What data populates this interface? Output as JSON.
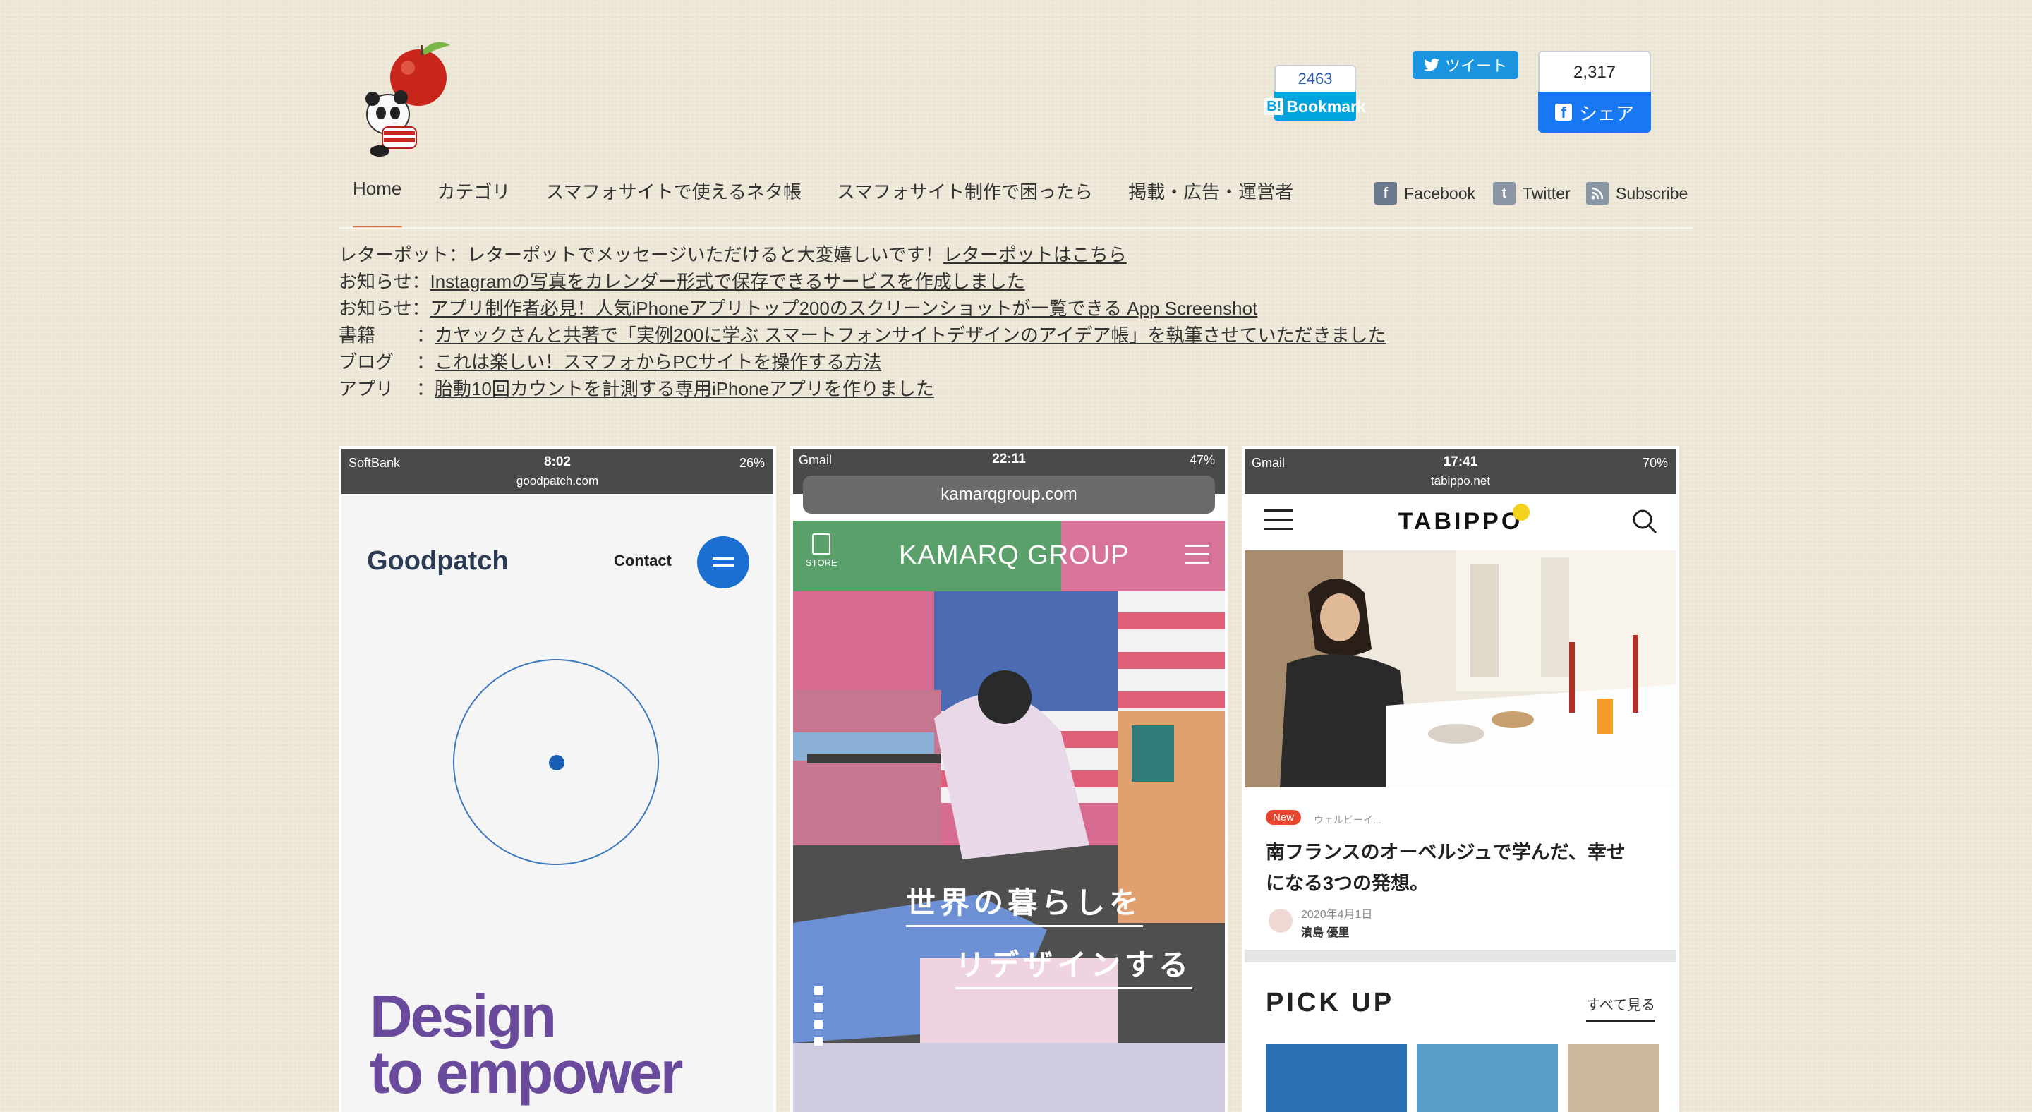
{
  "header": {
    "hatena": {
      "count": "2463",
      "label": "Bookmark",
      "b_icon": "B!"
    },
    "tweet": {
      "label": "ツイート"
    },
    "facebook_share": {
      "count": "2,317",
      "label": "シェア"
    }
  },
  "nav": {
    "items": [
      {
        "label": "Home"
      },
      {
        "label": "カテゴリ"
      },
      {
        "label": "スマフォサイトで使えるネタ帳"
      },
      {
        "label": "スマフォサイト制作で困ったら"
      },
      {
        "label": "掲載・広告・運営者"
      }
    ],
    "social": [
      {
        "label": "Facebook",
        "icon": "facebook-icon"
      },
      {
        "label": "Twitter",
        "icon": "twitter-icon"
      },
      {
        "label": "Subscribe",
        "icon": "rss-icon"
      }
    ]
  },
  "notices": [
    {
      "label": "レターポット",
      "sep": "：",
      "text": "レターポットでメッセージいただけると大変嬉しいです！",
      "link": "レターポットはこちら"
    },
    {
      "label": "お知らせ",
      "sep": "：",
      "text": "",
      "link": "Instagramの写真をカレンダー形式で保存できるサービスを作成しました"
    },
    {
      "label": "お知らせ",
      "sep": "：",
      "text": "",
      "link": "アプリ制作者必見！人気iPhoneアプリトップ200のスクリーンショットが一覧できる App Screenshot"
    },
    {
      "label": "書籍",
      "sep": "：",
      "text": "",
      "link": "カヤックさんと共著で「実例200に学ぶ スマートフォンサイトデザインのアイデア帳」を執筆させていただきました"
    },
    {
      "label": "ブログ",
      "sep": "：",
      "text": "",
      "link": "これは楽しい！スマフォからPCサイトを操作する方法"
    },
    {
      "label": "アプリ",
      "sep": "：",
      "text": "",
      "link": "胎動10回カウントを計測する専用iPhoneアプリを作りました"
    }
  ],
  "cards": {
    "goodpatch": {
      "carrier": "SoftBank",
      "time": "8:02",
      "battery": "26%",
      "url": "goodpatch.com",
      "logo": "Goodpatch",
      "contact": "Contact",
      "headline1": "Design",
      "headline2": "to empower"
    },
    "kamarq": {
      "carrier": "Gmail",
      "time": "22:11",
      "battery": "47%",
      "url": "kamarqgroup.com",
      "store": "STORE",
      "logo": "KAMARQ GROUP",
      "copy1": "世界の暮らしを",
      "copy2": "リデザインする"
    },
    "tabippo": {
      "carrier": "Gmail",
      "time": "17:41",
      "battery": "70%",
      "url": "tabippo.net",
      "logo": "TABIPPO",
      "badge": "New",
      "category": "ウェルビーイ...",
      "title1": "南フランスのオーベルジュで学んだ、幸せ",
      "title2": "になる3つの発想。",
      "date": "2020年4月1日",
      "author": "濱島 優里",
      "pickup": "PICK UP",
      "see_all": "すべて見る"
    }
  }
}
